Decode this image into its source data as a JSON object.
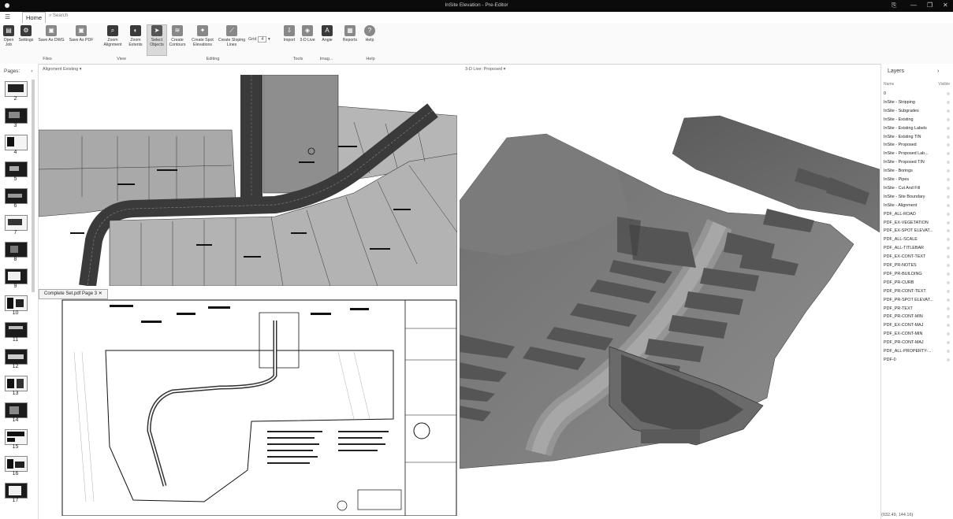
{
  "window": {
    "title": "InSite Elevation - Pre-Editor",
    "controls": [
      "⎘",
      "—",
      "❐",
      "✕"
    ]
  },
  "ribbon": {
    "file_icon": "☰",
    "tab_home": "Home",
    "search_label": "Search",
    "buttons": [
      {
        "label": "Open Job",
        "icon": "folder-icon"
      },
      {
        "label": "Settings",
        "icon": "gear-icon"
      },
      {
        "label": "Save As DWG",
        "icon": "save-dwg-icon"
      },
      {
        "label": "Save As PDF",
        "icon": "save-pdf-icon"
      },
      {
        "label": "Zoom Alignment",
        "icon": "zoom-alignment-icon"
      },
      {
        "label": "Zoom Extents",
        "icon": "zoom-extents-icon"
      },
      {
        "label": "Select Objects",
        "icon": "cursor-icon"
      },
      {
        "label": "Create Contours",
        "icon": "contours-icon"
      },
      {
        "label": "Create Spot Elevations",
        "icon": "spot-elevation-icon"
      },
      {
        "label": "Create Sloping Lines",
        "icon": "sloping-lines-icon"
      },
      {
        "label": "Import",
        "icon": "import-icon"
      },
      {
        "label": "3-D Live",
        "icon": "3d-live-icon"
      },
      {
        "label": "Angie",
        "icon": "angie-icon"
      },
      {
        "label": "Reports",
        "icon": "reports-icon"
      },
      {
        "label": "Help",
        "icon": "help-icon"
      }
    ],
    "grid_label": "Grid",
    "grid_value": "4",
    "groups": [
      "Files",
      "View",
      "Editing",
      "Tools",
      "Imag...",
      "Help"
    ]
  },
  "pages": {
    "header": "Pages",
    "numbers": [
      "2",
      "3",
      "4",
      "5",
      "6",
      "7",
      "8",
      "9",
      "10",
      "11",
      "12",
      "13",
      "14",
      "15",
      "16",
      "17"
    ]
  },
  "panes": {
    "map_header": "Alignment Existing",
    "view3d_header": "3-D Live: Proposed",
    "sheet_tab": "Complete Set.pdf Page 3"
  },
  "layers": {
    "header": "Layers",
    "col_name": "Name",
    "col_visible": "Visible",
    "items": [
      "0",
      "InSite - Stripping",
      "InSite - Subgrades",
      "InSite - Existing",
      "InSite - Existing Labels",
      "InSite - Existing TIN",
      "InSite - Proposed",
      "InSite - Proposed Lab...",
      "InSite - Proposed TIN",
      "InSite - Borings",
      "InSite - Pipes",
      "InSite - Cut And Fill",
      "InSite - Site Boundary",
      "InSite - Alignment",
      "PDF_ALL-ROAD",
      "PDF_EX-VEGETATION",
      "PDF_EX-SPOT ELEVAT...",
      "PDF_ALL-SCALE",
      "PDF_ALL-TITLEBAR",
      "PDF_EX-CONT-TEXT",
      "PDF_PR-NOTES",
      "PDF_PR-BUILDING",
      "PDF_PR-CURB",
      "PDF_PR-CONT-TEXT",
      "PDF_PR-SPOT ELEVAT...",
      "PDF_PR-TEXT",
      "PDF_PR-CONT-MIN",
      "PDF_EX-CONT-MAJ",
      "PDF_EX-CONT-MIN",
      "PDF_PR-CONT-MAJ",
      "PDF_ALL-PROPERTY-...",
      "PDF-0"
    ]
  },
  "status": {
    "coordinates": "(032.49, 144.16)"
  }
}
